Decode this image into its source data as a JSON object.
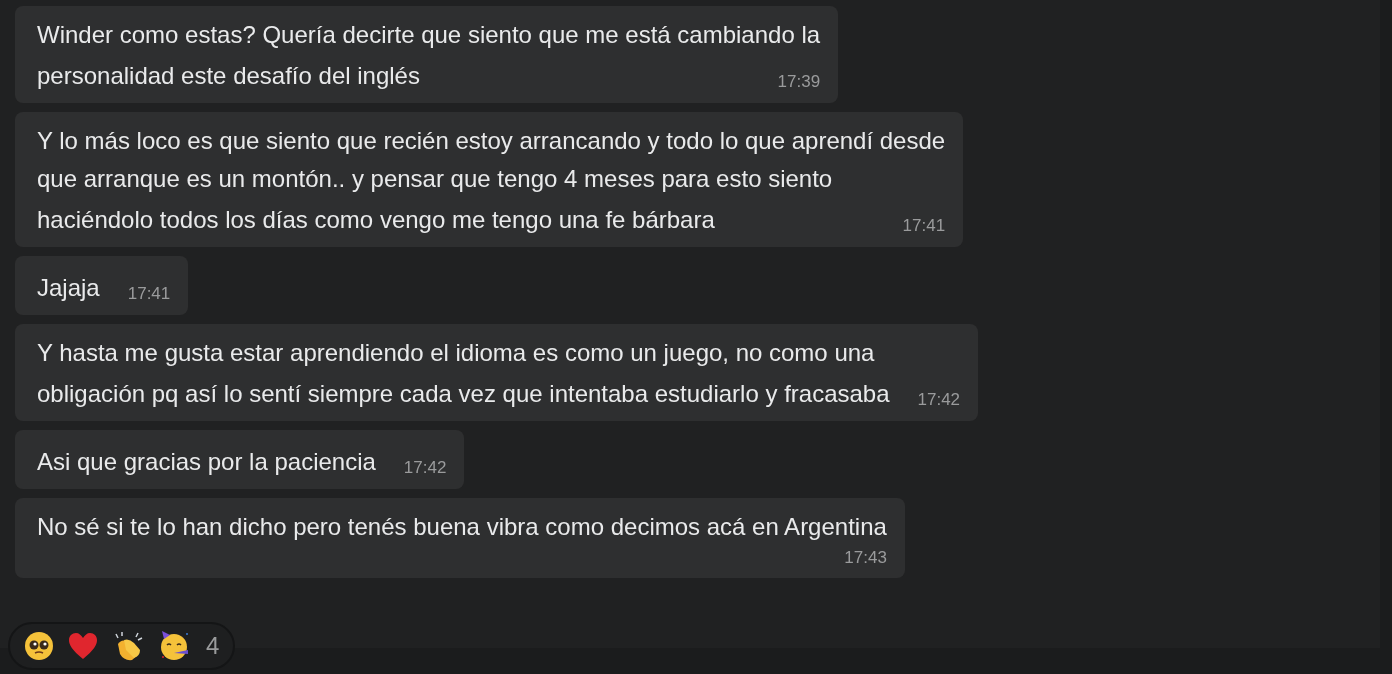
{
  "messages": [
    {
      "kind": "time_inline",
      "lines": [
        "Winder como estas? Quería decirte que siento que me está cambiando la",
        "personalidad este desafío del inglés"
      ],
      "time": "17:39"
    },
    {
      "kind": "time_inline",
      "lines": [
        "Y lo más loco es que siento que recién estoy arrancando y todo lo que aprendí desde",
        "que arranque es un montón.. y pensar que tengo 4 meses para esto siento",
        "haciéndolo todos los días como vengo me tengo una fe bárbara"
      ],
      "time": "17:41"
    },
    {
      "kind": "time_inline",
      "lines": [
        "Jajaja"
      ],
      "time": "17:41"
    },
    {
      "kind": "time_inline",
      "lines": [
        "Y hasta me gusta estar aprendiendo el idioma es como un juego, no como una",
        "obligación pq así lo sentí siempre cada vez que intentaba estudiarlo y fracasaba"
      ],
      "time": "17:42"
    },
    {
      "kind": "time_inline",
      "lines": [
        "Asi que gracias por la paciencia"
      ],
      "time": "17:42"
    },
    {
      "kind": "time_below",
      "lines": [
        "No sé si te lo han dicho pero tenés buena vibra como decimos acá en Argentina"
      ],
      "time": "17:43"
    }
  ],
  "reactions": {
    "count": "4"
  }
}
